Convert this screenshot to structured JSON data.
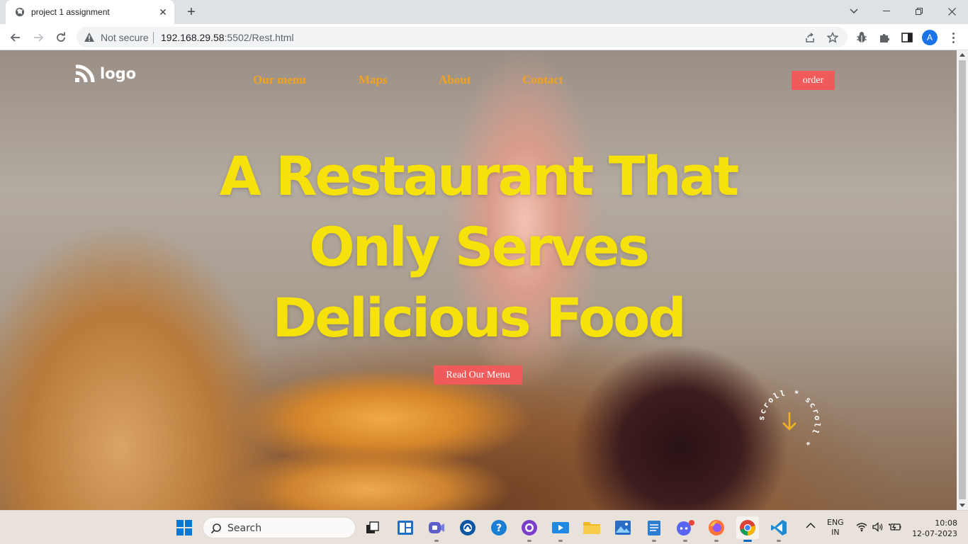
{
  "browser": {
    "tab_title": "project 1 assignment",
    "omnibox": {
      "security_label": "Not secure",
      "url_host": "192.168.29.58",
      "url_path": ":5502/Rest.html"
    },
    "profile_initial": "A"
  },
  "page": {
    "logo_text": "logo",
    "nav_links": [
      "Our menu",
      "Maps",
      "About",
      "Contact"
    ],
    "order_label": "order",
    "hero_lines": [
      "A Restaurant That",
      "Only Serves",
      "Delicious Food"
    ],
    "cta_label": "Read Our Menu",
    "scroll_badge_text": "scroll * scroll * ",
    "colors": {
      "hero_text": "#f7e10a",
      "nav_link": "#f4a21a",
      "button_bg": "#f05a5a",
      "scroll_arrow": "#f5b51e"
    }
  },
  "taskbar": {
    "search_placeholder": "Search",
    "apps": [
      "start-icon",
      "task-view-icon",
      "widgets-icon",
      "teams-chat-icon",
      "edge-store-icon",
      "help-icon",
      "github-icon",
      "media-player-icon",
      "file-explorer-icon",
      "photos-icon",
      "notepad-icon",
      "discord-icon",
      "firefox-icon",
      "chrome-icon",
      "vscode-icon"
    ],
    "language": [
      "ENG",
      "IN"
    ],
    "time": "10:08",
    "date": "12-07-2023"
  }
}
